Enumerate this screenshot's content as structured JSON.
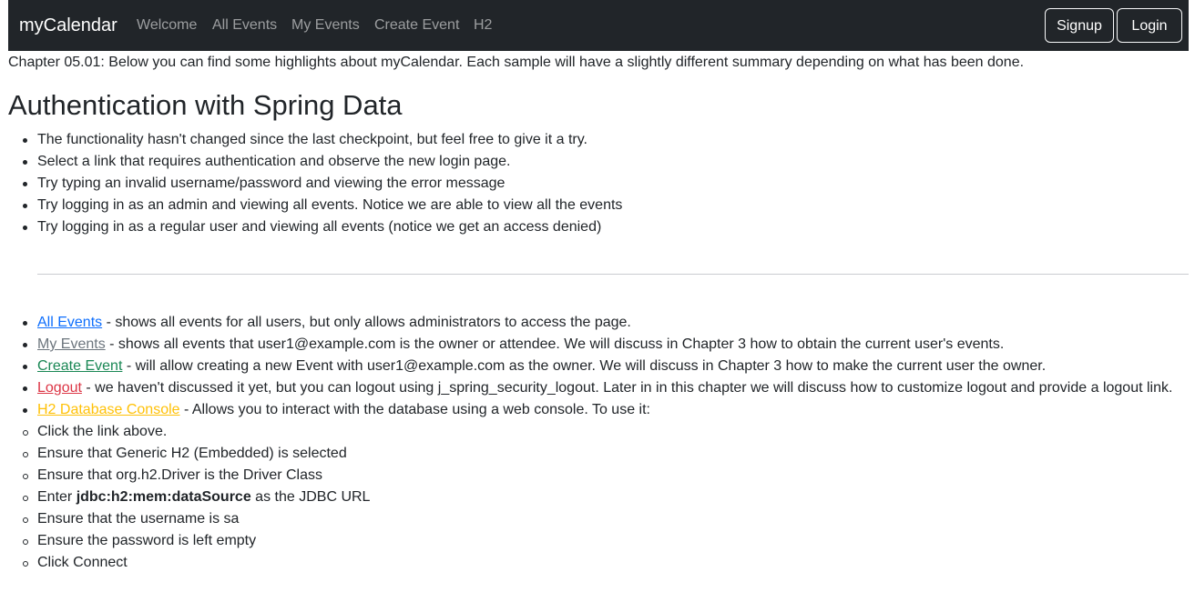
{
  "navbar": {
    "brand": "myCalendar",
    "links": [
      "Welcome",
      "All Events",
      "My Events",
      "Create Event",
      "H2"
    ],
    "buttons": [
      "Signup",
      "Login"
    ],
    "background": "#212529"
  },
  "intro": "Chapter 05.01: Below you can find some highlights about myCalendar. Each sample will have a slightly different summary depending on what has been done.",
  "heading": "Authentication with Spring Data",
  "highlights": [
    "The functionality hasn't changed since the last checkpoint, but feel free to give it a try.",
    "Select a link that requires authentication and observe the new login page.",
    "Try typing an invalid username/password and viewing the error message",
    "Try logging in as an admin and viewing all events. Notice we are able to view all the events",
    "Try logging in as a regular user and viewing all events (notice we get an access denied)"
  ],
  "links": {
    "all_events": {
      "label": "All Events",
      "description": " - shows all events for all users, but only allows administrators to access the page.",
      "color": "#0d6efd"
    },
    "my_events": {
      "label": "My Events",
      "description": " - shows all events that user1@example.com is the owner or attendee. We will discuss in Chapter 3 how to obtain the current user's events.",
      "color": "#6c757d"
    },
    "create_event": {
      "label": "Create Event",
      "description": " - will allow creating a new Event with user1@example.com as the owner. We will discuss in Chapter 3 how to make the current user the owner.",
      "color": "#198754"
    },
    "logout": {
      "label": "Logout",
      "description": " - we haven't discussed it yet, but you can logout using j_spring_security_logout. Later in in this chapter we will discuss how to customize logout and provide a logout link.",
      "color": "#dc3545"
    },
    "h2_console": {
      "label": "H2 Database Console",
      "description": " - Allows you to interact with the database using a web console. To use it:",
      "color": "#ffc107"
    }
  },
  "h2_steps": {
    "click_link": "Click the link above.",
    "generic_h2": "Ensure that Generic H2 (Embedded) is selected",
    "driver": "Ensure that org.h2.Driver is the Driver Class",
    "enter_prefix": "Enter ",
    "jdbc_url": "jdbc:h2:mem:dataSource",
    "enter_suffix": " as the JDBC URL",
    "username": "Ensure that the username is sa",
    "password": "Ensure the password is left empty",
    "connect": "Click Connect"
  }
}
